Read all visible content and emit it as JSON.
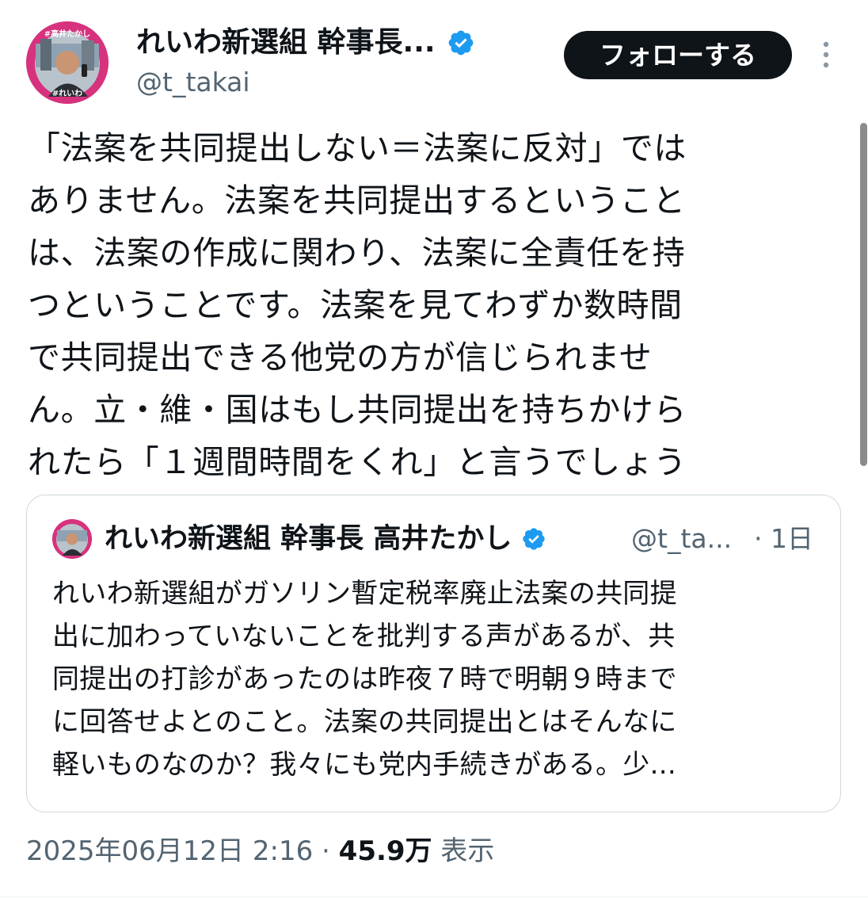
{
  "author": {
    "display_name": "れいわ新選組 幹事長...",
    "handle": "@t_takai",
    "avatar_badge_top": "#高井たかし",
    "avatar_badge_bottom": "#れいわ"
  },
  "follow_label": "フォローする",
  "tweet_text": "「法案を共同提出しない＝法案に反対」では\nありません。法案を共同提出するということ\nは、法案の作成に関わり、法案に全責任を持\nつということです。法案を見てわずか数時間\nで共同提出できる他党の方が信じられませ\nん。立・維・国はもし共同提出を持ちかけら\nれたら「１週間時間をくれ」と言うでしょう",
  "quote": {
    "display_name": "れいわ新選組 幹事長 高井たかし",
    "handle": "@t_ta...",
    "time": "· 1日",
    "text": "れいわ新選組がガソリン暫定税率廃止法案の共同提\n出に加わっていないことを批判する声があるが、共\n同提出の打診があったのは昨夜７時で明朝９時まで\nに回答せよとのこと。法案の共同提出とはそんなに\n軽いものなのか？我々にも党内手続きがある。少..."
  },
  "meta": {
    "timestamp": "2025年06月12日 2:16",
    "separator": " · ",
    "views": "45.9万",
    "views_label": " 表示"
  },
  "colors": {
    "text_primary": "#0f1419",
    "text_secondary": "#536471",
    "verified_blue": "#1d9bf0",
    "follow_button": "#0f1419",
    "avatar_pink": "#d6327e"
  },
  "icons": {
    "verified": "verified-badge-icon",
    "more": "more-vertical-icon"
  }
}
